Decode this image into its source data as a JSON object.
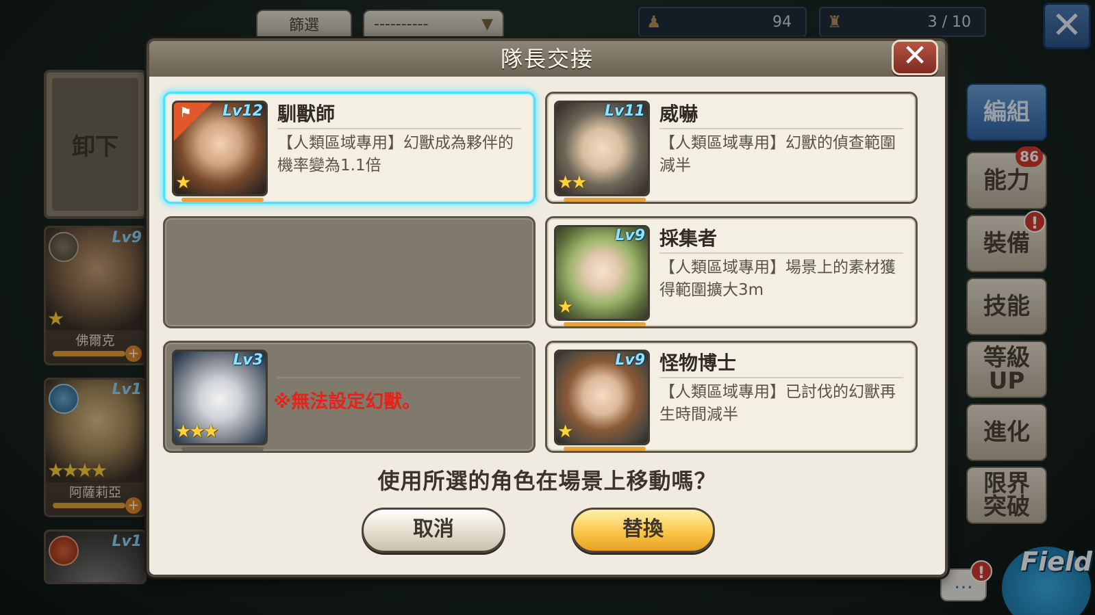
{
  "top_bar": {
    "filter_label": "篩選",
    "sort_value": "----------",
    "unit_count": "94",
    "party_count": "3 / 10"
  },
  "left_panel": {
    "unequip_label": "卸下",
    "cards": [
      {
        "name": "佛爾克",
        "level": "Lv9",
        "stars": "★"
      },
      {
        "name": "阿薩莉亞",
        "level": "Lv1",
        "stars": "★★★★"
      },
      {
        "name": "",
        "level": "Lv1",
        "stars": ""
      }
    ]
  },
  "right_menu": {
    "items": [
      {
        "label": "編組",
        "active": true
      },
      {
        "label": "能力",
        "badge": "86"
      },
      {
        "label": "裝備",
        "alert": "!"
      },
      {
        "label": "技能"
      },
      {
        "label": "等級\nUP"
      },
      {
        "label": "進化"
      },
      {
        "label": "限界\n突破"
      }
    ],
    "field_label": "Field",
    "chat_glyph": "…",
    "chat_alert": "!"
  },
  "dialog": {
    "title": "隊長交接",
    "close_glyph": "✕",
    "skills": [
      {
        "title": "馴獸師",
        "level": "Lv12",
        "stars": "★",
        "description": "【人類區域專用】幻獸成為夥伴的機率變為1.1倍",
        "selected": true
      },
      {
        "title": "威嚇",
        "level": "Lv11",
        "stars": "★★",
        "description": "【人類區域專用】幻獸的偵查範圍減半"
      },
      {
        "title": "",
        "empty": true
      },
      {
        "title": "採集者",
        "level": "Lv9",
        "stars": "★",
        "description": "【人類區域專用】場景上的素材獲得範圍擴大3m"
      },
      {
        "title": "",
        "level": "Lv3",
        "stars": "★★★",
        "warning": "※無法設定幻獸。",
        "disabled": true
      },
      {
        "title": "怪物博士",
        "level": "Lv9",
        "stars": "★",
        "description": "【人類區域專用】已討伐的幻獸再生時間減半"
      }
    ],
    "question": "使用所選的角色在場景上移動嗎？",
    "cancel_label": "取消",
    "replace_label": "替換"
  },
  "colors": {
    "selected_glow": "#4fe0ff",
    "warning_red": "#e5231a",
    "replace_button": "#fbc64a",
    "level_text": "#8fe2ff"
  }
}
